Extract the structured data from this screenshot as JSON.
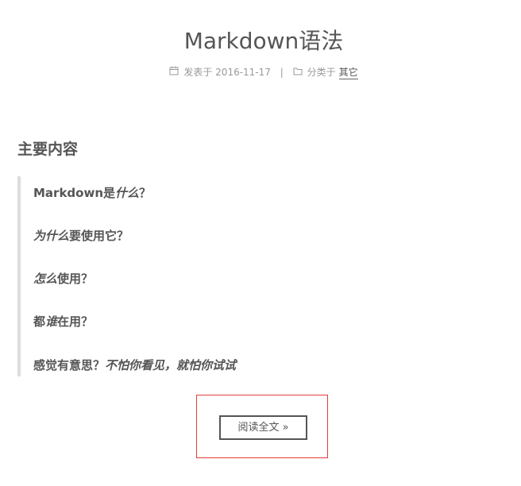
{
  "post": {
    "title": "Markdown语法",
    "meta": {
      "published_label": "发表于",
      "published_date": "2016-11-17",
      "divider": "|",
      "category_label": "分类于",
      "category": "其它"
    }
  },
  "content": {
    "heading": "主要内容",
    "quote": [
      {
        "normal": "Markdown是",
        "italic": "什么",
        "rest": "？"
      },
      {
        "normal": "",
        "italic": "为什么",
        "rest": "要使用它？"
      },
      {
        "normal": "",
        "italic": "怎么",
        "rest": "使用？"
      },
      {
        "normal": "都",
        "italic": "谁",
        "rest": "在用？"
      },
      {
        "normal": "感觉有意思？",
        "italic": "不怕你看见，就怕你试试",
        "rest": ""
      }
    ]
  },
  "read_more": {
    "label": "阅读全文 »"
  },
  "colors": {
    "text": "#555555",
    "meta_text": "#999999",
    "quote_border": "#dddddd",
    "highlight_box": "#e33b3b"
  },
  "icons": {
    "date": "calendar-icon",
    "category": "folder-icon"
  }
}
